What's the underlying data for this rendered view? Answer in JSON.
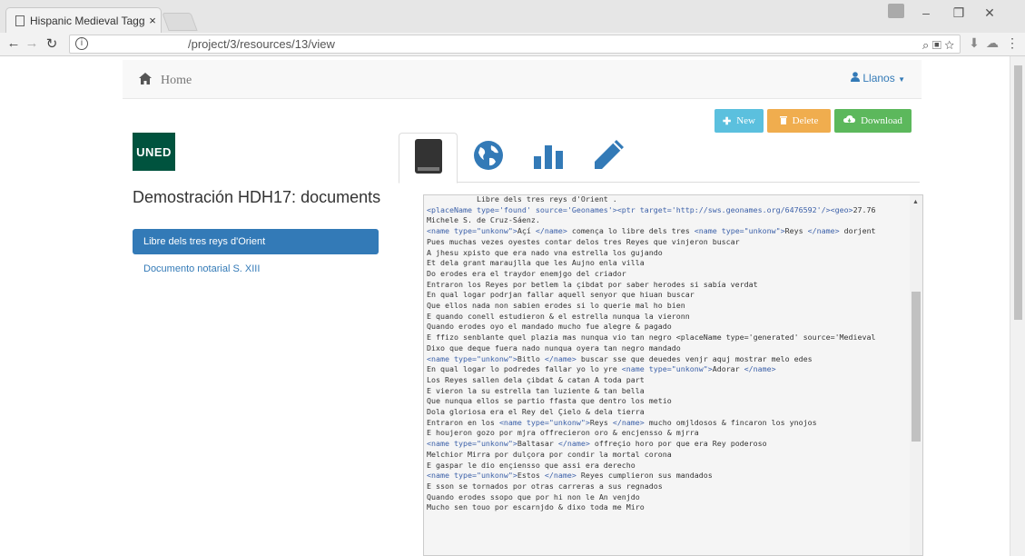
{
  "browser": {
    "tab_title": "Hispanic Medieval Tagge",
    "tab_close": "×",
    "url": "/project/3/resources/13/view",
    "omni_icons": "⌕ ▣ ☆"
  },
  "navbar": {
    "home_label": "Home",
    "user_label": "Llanos"
  },
  "actions": {
    "new_label": "New",
    "delete_label": "Delete",
    "download_label": "Download"
  },
  "logo_text": "UNED",
  "project_title": "Demostración HDH17: documents",
  "documents": [
    {
      "label": "Libre dels tres reys d'Orient",
      "active": true
    },
    {
      "label": "Documento notarial S. XIII",
      "active": false
    }
  ],
  "colors": {
    "primary": "#337ab7",
    "info": "#5bc0de",
    "warning": "#f0ad4e",
    "success": "#5cb85c",
    "logo_bg": "#00533e",
    "tab_icon": "#333333",
    "globe_icon": "#337ab7"
  },
  "view_tabs": [
    {
      "name": "book-icon",
      "active": true
    },
    {
      "name": "globe-icon",
      "active": false
    },
    {
      "name": "bar-chart-icon",
      "active": false
    },
    {
      "name": "pencil-icon",
      "active": false
    }
  ],
  "content_lines": [
    "           Libre dels tres reys d'Orient .",
    "<placeName type='found' source='Geonames'><ptr target='http://sws.geonames.org/6476592'/><geo>27.76",
    "Michele S. de Cruz-Sáenz.",
    "<name type=\"unkonw\">Açí </name> començа lo libre dels tres <name type=\"unkonw\">Reys </name> dorjent",
    "Pues muchas vezes oyestes contar delos tres Reyes que vinjeron buscar",
    "A jhesu xpisto que era nado vna estrella los gujando",
    "Et dela grant maraujlla que les Aujno enla villa",
    "Do erodes era el traydor enemjgo del criador",
    "Entraron los Reyes por betlem la çibdat por saber herodes si sabía verdat",
    "En qual logar podrjan fallar aquell senyor que hiuan buscar",
    "Que ellos nada non sabien erodes si lo querie mal ho bien",
    "E quando conell estudieron & el estrella nunqua la vieronn",
    "Quando erodes oyo el mandado mucho fue alegre & pagado",
    "E ffizo senblante quel plazia mas nunqua vio tan negro <placeName type='generated' source='Medieval",
    "Dixo que deque fuera nado nunqua oyera tan negro mandado",
    "<name type=\"unkonw\">Bitlo </name> buscar sse que deuedes venjr aquj mostrar melo edes",
    "En qual logar lo podredes fallar yo lo yre <name type=\"unkonw\">Adorar </name>",
    "Los Reyes sallen dela çibdat & catan A toda part",
    "E vieron la su estrella tan luziente & tan bella",
    "Que nunqua ellos se partio ffasta que dentro los metio",
    "Dola gloriosa era el Rey del Çielo & dela tierra",
    "Entraron en los <name type=\"unkonw\">Reys </name> mucho omjldosos & fincaron los ynojos",
    "E houjeron gozo por mjra offrecieron oro & encjensso & mjrra",
    "<name type=\"unkonw\">Baltasar </name> offreçio horo por que era Rey poderoso",
    "Melchior Mirra por dulçora por condir la mortal corona",
    "E gaspar le dio ençiensso que assi era derecho",
    "<name type=\"unkonw\">Estos </name> Reyes cumplieron sus mandados",
    "E sson se tornados por otras carreras a sus regnados",
    "Quando erodes ssopo que por hi non le An venjdo",
    "Mucho sen touo por escarnjdo & dixo toda me Miro"
  ]
}
